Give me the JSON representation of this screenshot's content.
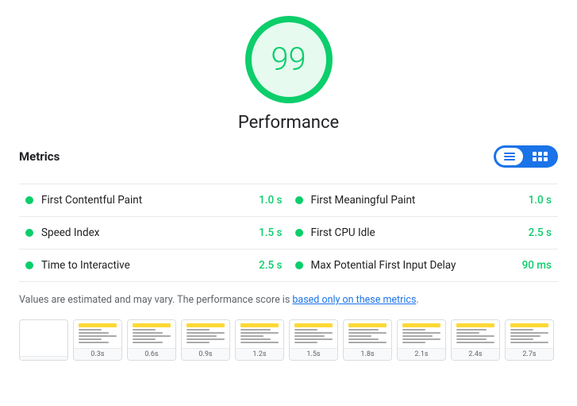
{
  "score": {
    "value": "99",
    "label": "Performance"
  },
  "metrics_section": {
    "title": "Metrics",
    "toggle": {
      "list_label": "list view",
      "grid_label": "grid view"
    },
    "items": [
      {
        "name": "First Contentful Paint",
        "value": "1.0 s",
        "color": "#0cce6b"
      },
      {
        "name": "First Meaningful Paint",
        "value": "1.0 s",
        "color": "#0cce6b"
      },
      {
        "name": "Speed Index",
        "value": "1.5 s",
        "color": "#0cce6b"
      },
      {
        "name": "First CPU Idle",
        "value": "2.5 s",
        "color": "#0cce6b"
      },
      {
        "name": "Time to Interactive",
        "value": "2.5 s",
        "color": "#0cce6b"
      },
      {
        "name": "Max Potential First Input Delay",
        "value": "90 ms",
        "color": "#0cce6b"
      }
    ]
  },
  "footer": {
    "note": "Values are estimated and may vary. The performance score is ",
    "link_text": "based only on these metrics",
    "note_end": "."
  },
  "filmstrip": {
    "frames": [
      {
        "timestamp": ""
      },
      {
        "timestamp": "0.3s"
      },
      {
        "timestamp": "0.6s"
      },
      {
        "timestamp": "0.9s"
      },
      {
        "timestamp": "1.2s"
      },
      {
        "timestamp": "1.5s"
      },
      {
        "timestamp": "1.8s"
      },
      {
        "timestamp": "2.1s"
      },
      {
        "timestamp": "2.4s"
      },
      {
        "timestamp": "2.7s"
      }
    ]
  }
}
